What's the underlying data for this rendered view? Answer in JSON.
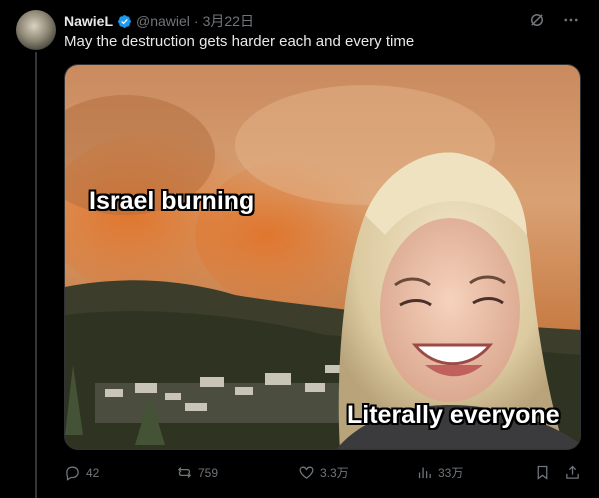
{
  "tweet": {
    "author_name": "NawieL",
    "handle": "@nawiel",
    "separator": "·",
    "date": "3月22日",
    "text": "May the destruction gets harder each and every time"
  },
  "media": {
    "caption_top": "Israel burning",
    "caption_bottom": "Literally everyone"
  },
  "actions": {
    "replies": "42",
    "reposts": "759",
    "likes": "3.3万",
    "views": "33万"
  },
  "icons": {
    "verified": "verified-badge-icon",
    "grok": "grok-icon",
    "more": "more-icon",
    "reply": "reply-icon",
    "repost": "repost-icon",
    "like": "heart-icon",
    "views": "views-icon",
    "bookmark": "bookmark-icon",
    "share": "share-icon"
  },
  "colors": {
    "accent": "#1d9bf0",
    "muted": "#71767b",
    "text": "#e7e9ea",
    "background": "#000000"
  }
}
